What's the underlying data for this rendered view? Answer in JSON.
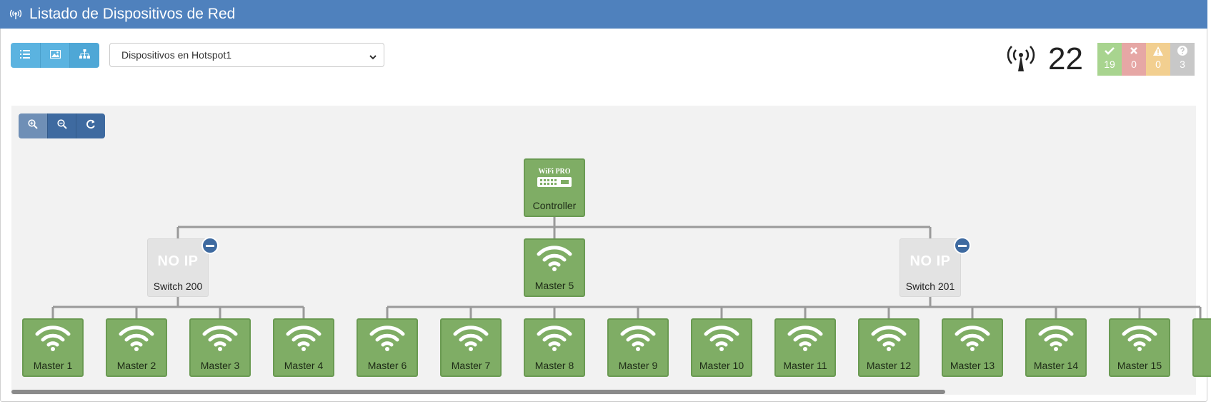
{
  "header": {
    "title": "Listado de Dispositivos de Red",
    "icon": "broadcast-icon"
  },
  "toolbar": {
    "view_buttons": [
      {
        "name": "list-view",
        "icon": "list-icon"
      },
      {
        "name": "image-view",
        "icon": "image-icon"
      },
      {
        "name": "tree-view",
        "icon": "sitemap-icon"
      }
    ],
    "filter_select": {
      "value": "Dispositivos en Hotspot1"
    }
  },
  "summary": {
    "total": "22",
    "statuses": [
      {
        "name": "ok",
        "icon": "check-icon",
        "count": "19",
        "color": "#a8d48f"
      },
      {
        "name": "down",
        "icon": "times-icon",
        "count": "0",
        "color": "#e6a7a5"
      },
      {
        "name": "warning",
        "icon": "warning-icon",
        "count": "0",
        "color": "#f2cf90"
      },
      {
        "name": "unknown",
        "icon": "question-icon",
        "count": "3",
        "color": "#c8c8c8"
      }
    ]
  },
  "zoom": {
    "buttons": [
      "zoom-in-icon",
      "zoom-out-icon",
      "reset-icon"
    ]
  },
  "tree": {
    "root": {
      "label": "Controller",
      "logo_text": "WiFi PRO"
    },
    "level1": [
      {
        "label": "Switch 200",
        "badge": "NO IP",
        "status": "unknown",
        "collapsible": true
      },
      {
        "label": "Master 5",
        "status": "ok"
      },
      {
        "label": "Switch 201",
        "badge": "NO IP",
        "status": "unknown",
        "collapsible": true
      }
    ],
    "level2": [
      "Master 1",
      "Master 2",
      "Master 3",
      "Master 4",
      "Master 6",
      "Master 7",
      "Master 8",
      "Master 9",
      "Master 10",
      "Master 11",
      "Master 12",
      "Master 13",
      "Master 14",
      "Master 15"
    ]
  },
  "colors": {
    "header": "#4f81bd",
    "node_ok": "#7fad65",
    "node_unknown": "#e3e3e3",
    "accent": "#3e6aa0"
  }
}
